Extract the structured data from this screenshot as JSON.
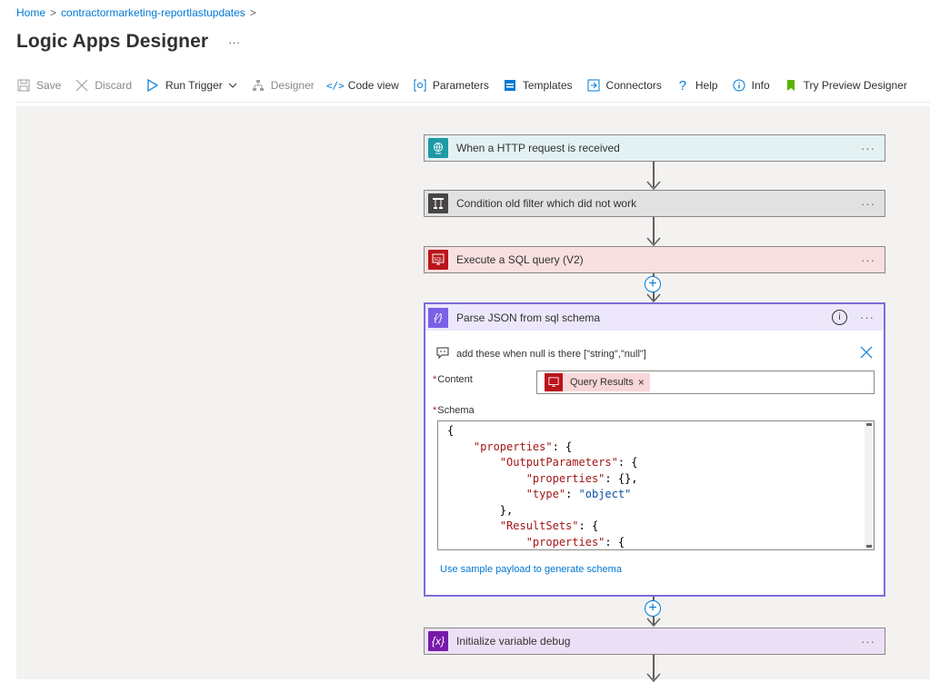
{
  "breadcrumb": {
    "home": "Home",
    "separator": ">",
    "resource": "contractormarketing-reportlastupdates"
  },
  "page": {
    "title": "Logic Apps Designer",
    "more": "···"
  },
  "toolbar": {
    "save": "Save",
    "discard": "Discard",
    "run_trigger": "Run Trigger",
    "designer": "Designer",
    "code_view": "Code view",
    "parameters": "Parameters",
    "templates": "Templates",
    "connectors": "Connectors",
    "help": "Help",
    "info": "Info",
    "try_preview": "Try Preview Designer"
  },
  "steps": {
    "http": {
      "title": "When a HTTP request is received",
      "color": "#e3f1f3",
      "icon_color": "#1e9aa5",
      "icon": "globe-icon"
    },
    "condition": {
      "title": "Condition old filter which did not work",
      "color": "#e1e1e1",
      "icon_color": "#484644",
      "icon": "condition-icon"
    },
    "sql": {
      "title": "Execute a SQL query (V2)",
      "color": "#f9e0e0",
      "icon_color": "#ba141a",
      "icon": "sql-icon"
    },
    "init": {
      "title": "Initialize variable debug",
      "color": "#ece0f7",
      "icon_color": "#7719aa",
      "icon": "variable-icon"
    },
    "more": "···"
  },
  "parse": {
    "title": "Parse JSON from sql schema",
    "comment": "add these when null is there [\"string\",\"null\"]",
    "content_label": "Content",
    "content_token": "Query Results",
    "schema_label": "Schema",
    "required_marker": "*",
    "sample_link": "Use sample payload to generate schema",
    "more": "···"
  }
}
